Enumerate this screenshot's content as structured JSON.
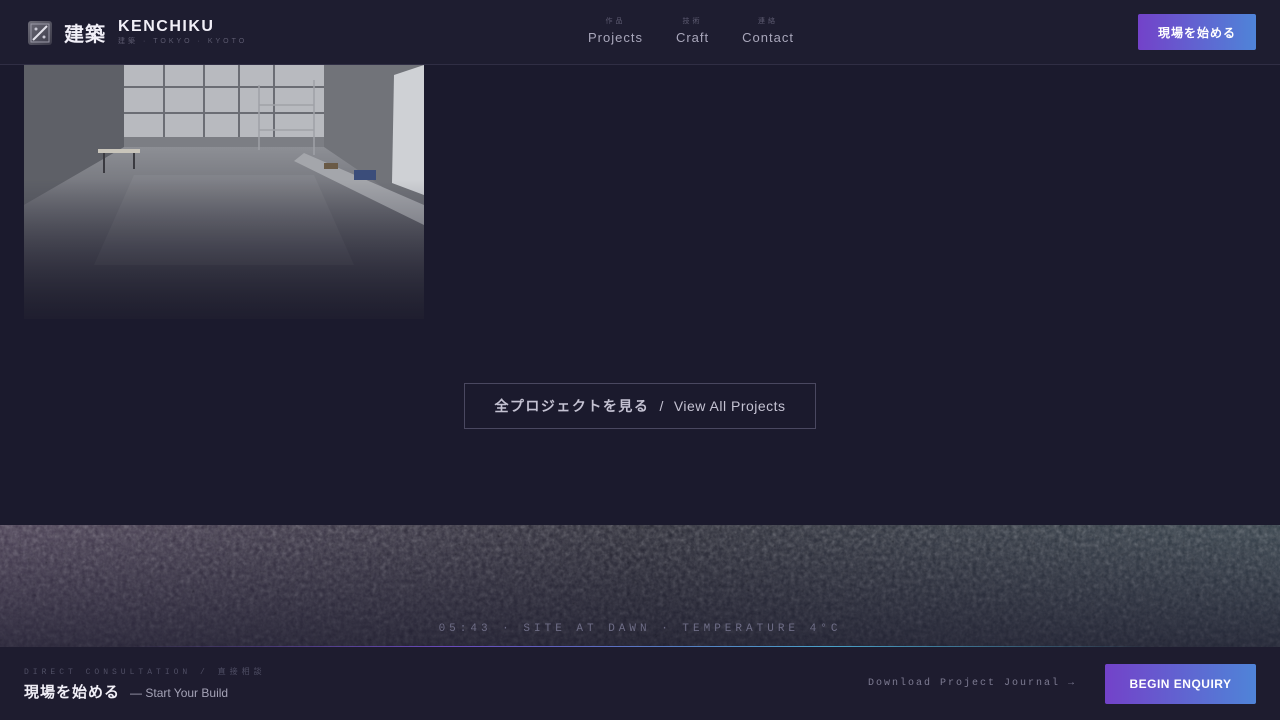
{
  "header": {
    "brand_kanji": "建築",
    "brand_name": "KENCHIKU",
    "brand_sub": "建築 · TOKYO · KYOTO",
    "nav": [
      {
        "kanji": "作品",
        "label": "Projects"
      },
      {
        "kanji": "技術",
        "label": "Craft"
      },
      {
        "kanji": "連絡",
        "label": "Contact"
      }
    ],
    "cta_label": "現場を始める"
  },
  "projects": {
    "view_all_jp": "全プロジェクトを見る",
    "view_all_sep": "/",
    "view_all_en": "View All Projects"
  },
  "site_status": {
    "caption": "05:43 · SITE AT DAWN · TEMPERATURE 4°C"
  },
  "footer": {
    "eyebrow": "DIRECT CONSULTATION / 直接相談",
    "title_jp": "現場を始める",
    "title_en": "— Start Your Build",
    "journal_link": "Download Project Journal →",
    "cta_label": "BEGIN ENQUIRY"
  },
  "colors": {
    "background": "#1b1a2d",
    "accent_start": "#7342c9",
    "accent_end": "#4f84d8"
  }
}
